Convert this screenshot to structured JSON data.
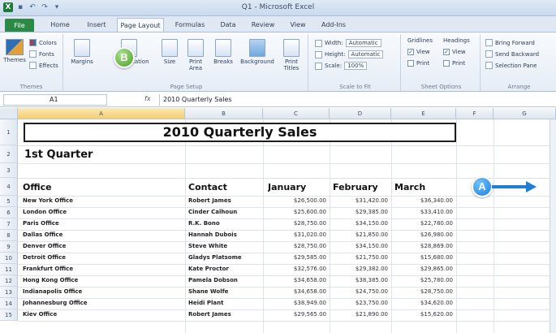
{
  "window": {
    "title": "Q1 - Microsoft Excel"
  },
  "tabs": [
    "File",
    "Home",
    "Insert",
    "Page Layout",
    "Formulas",
    "Data",
    "Review",
    "View",
    "Add-Ins"
  ],
  "ribbon": {
    "themes": {
      "label": "Themes",
      "colors": "Colors",
      "fonts": "Fonts",
      "effects": "Effects",
      "group": "Themes"
    },
    "page_setup": {
      "margins": "Margins",
      "orientation": "Orientation",
      "size": "Size",
      "print_area": "Print Area",
      "breaks": "Breaks",
      "background": "Background",
      "print_titles": "Print Titles",
      "group": "Page Setup"
    },
    "scale": {
      "width_label": "Width:",
      "width_value": "Automatic",
      "height_label": "Height:",
      "height_value": "Automatic",
      "scale_label": "Scale:",
      "scale_value": "100%",
      "group": "Scale to Fit"
    },
    "sheet_options": {
      "gridlines": "Gridlines",
      "headings": "Headings",
      "view": "View",
      "print": "Print",
      "group": "Sheet Options"
    },
    "arrange": {
      "bring_forward": "Bring Forward",
      "send_backward": "Send Backward",
      "selection_pane": "Selection Pane",
      "group": "Arrange"
    }
  },
  "formula_bar": {
    "name_box": "A1",
    "fx": "fx",
    "content": "2010 Quarterly Sales"
  },
  "columns": [
    "A",
    "B",
    "C",
    "D",
    "E",
    "F",
    "G"
  ],
  "rows": [
    "1",
    "2",
    "3",
    "4",
    "5",
    "6",
    "7",
    "8",
    "9",
    "10",
    "11",
    "12",
    "13",
    "14",
    "15"
  ],
  "sheet": {
    "title": "2010 Quarterly Sales",
    "subtitle": "1st Quarter",
    "headers": [
      "Office",
      "Contact",
      "January",
      "February",
      "March"
    ],
    "data": [
      [
        "New York Office",
        "Robert James",
        "$26,500.00",
        "$31,420.00",
        "$36,340.00"
      ],
      [
        "London Office",
        "Cinder Calhoun",
        "$25,600.00",
        "$29,385.00",
        "$33,410.00"
      ],
      [
        "Paris Office",
        "R.K. Bono",
        "$28,750.00",
        "$34,150.00",
        "$22,780.00"
      ],
      [
        "Dallas Office",
        "Hannah Dubois",
        "$31,020.00",
        "$21,850.00",
        "$26,980.00"
      ],
      [
        "Denver Office",
        "Steve White",
        "$28,750.00",
        "$34,150.00",
        "$28,869.00"
      ],
      [
        "Detroit Office",
        "Gladys Platsome",
        "$29,585.00",
        "$21,750.00",
        "$15,680.00"
      ],
      [
        "Frankfurt Office",
        "Kate Proctor",
        "$32,576.00",
        "$29,382.00",
        "$29,865.00"
      ],
      [
        "Hong Kong Office",
        "Pamela Dobson",
        "$34,658.00",
        "$38,385.00",
        "$25,780.00"
      ],
      [
        "Indianapolis Office",
        "Shane Wolfe",
        "$34,658.00",
        "$24,750.00",
        "$28,750.00"
      ],
      [
        "Johannesburg Office",
        "Heidi Plant",
        "$38,949.00",
        "$23,750.00",
        "$34,620.00"
      ],
      [
        "Kiev Office",
        "Robert James",
        "$29,565.00",
        "$21,890.00",
        "$15,620.00"
      ]
    ]
  },
  "callouts": {
    "a": "A",
    "b": "B"
  },
  "colors": {
    "file_tab": "#2a8a46",
    "callout_a": "#1f7fd6",
    "callout_b": "#4c9e2c",
    "selected_header": "#f4cf73"
  }
}
